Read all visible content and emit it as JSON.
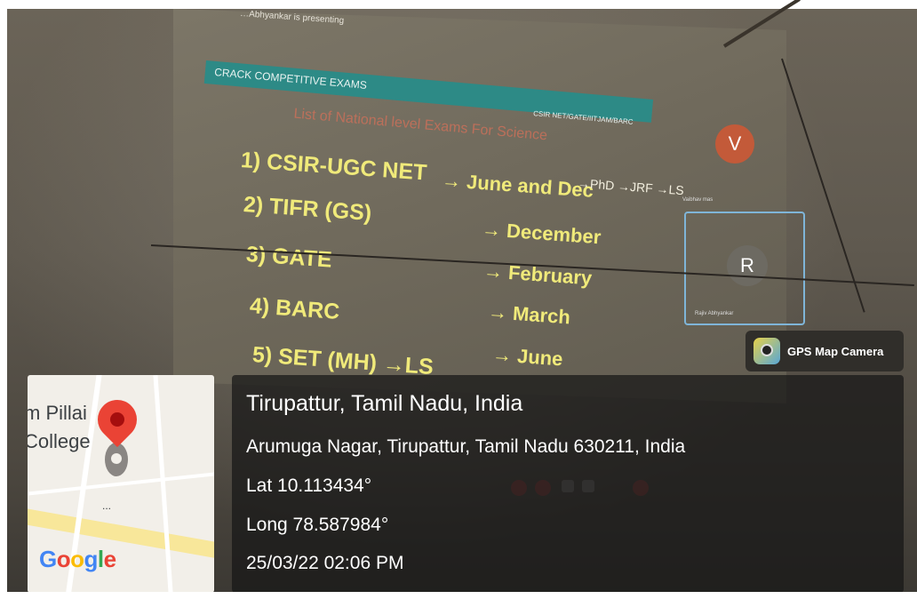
{
  "projection": {
    "presenter_text": "…Abhyankar is presenting",
    "banner_title": "CRACK COMPETITIVE EXAMS",
    "banner_subtitle": "CSIR NET/GATE/IITJAM/BARC",
    "heading": "List of National level Exams For Science",
    "exams": [
      {
        "name": "1) CSIR-UGC NET",
        "when": "→ June and Dec"
      },
      {
        "name": "2) TIFR (GS)",
        "when": "→ December"
      },
      {
        "name": "3) GATE",
        "when": "→ February"
      },
      {
        "name": "4) BARC",
        "when": "→ March"
      },
      {
        "name": "5) SET (MH) →LS",
        "when": "→ June"
      }
    ],
    "handwritten_note": "→PhD →JRF  →LS",
    "participants": [
      {
        "initial": "V",
        "name": "Vaibhav mas"
      },
      {
        "initial": "R",
        "name": "Rajiv Abhyankar"
      }
    ]
  },
  "gps": {
    "badge_label": "GPS Map Camera",
    "map_labels": {
      "line1": "m Pillai",
      "line2": "College",
      "dots": "..."
    },
    "google_word": [
      "G",
      "o",
      "o",
      "g",
      "l",
      "e"
    ],
    "google_colors": [
      "#4285f4",
      "#ea4335",
      "#fbbc05",
      "#4285f4",
      "#34a853",
      "#ea4335"
    ],
    "place_title": "Tirupattur, Tamil Nadu, India",
    "address": "Arumuga Nagar, Tirupattur, Tamil Nadu 630211, India",
    "lat": "Lat 10.113434°",
    "long": "Long 78.587984°",
    "datetime": "25/03/22 02:06 PM"
  },
  "colors": {
    "banner": "#2d8a86",
    "slide_text": "#f0ea7a",
    "pin": "#ea4335"
  }
}
